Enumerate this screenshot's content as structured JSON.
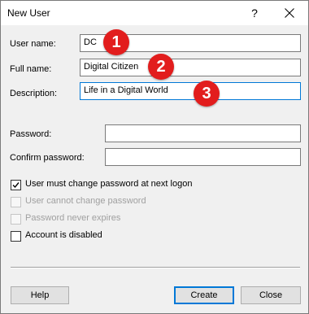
{
  "window": {
    "title": "New User",
    "help_glyph": "?"
  },
  "form": {
    "username_label": "User name:",
    "username_value": "DC",
    "fullname_label": "Full name:",
    "fullname_value": "Digital Citizen",
    "description_label": "Description:",
    "description_value": "Life in a Digital World",
    "password_label": "Password:",
    "password_value": "",
    "confirm_label": "Confirm password:",
    "confirm_value": ""
  },
  "annotations": [
    "1",
    "2",
    "3"
  ],
  "options": [
    {
      "label": "User must change password at next logon",
      "checked": true,
      "enabled": true
    },
    {
      "label": "User cannot change password",
      "checked": false,
      "enabled": false
    },
    {
      "label": "Password never expires",
      "checked": false,
      "enabled": false
    },
    {
      "label": "Account is disabled",
      "checked": false,
      "enabled": true
    }
  ],
  "buttons": {
    "help": "Help",
    "create": "Create",
    "close": "Close"
  },
  "colors": {
    "badge": "#e21d1d",
    "focus_border": "#0078d7"
  }
}
